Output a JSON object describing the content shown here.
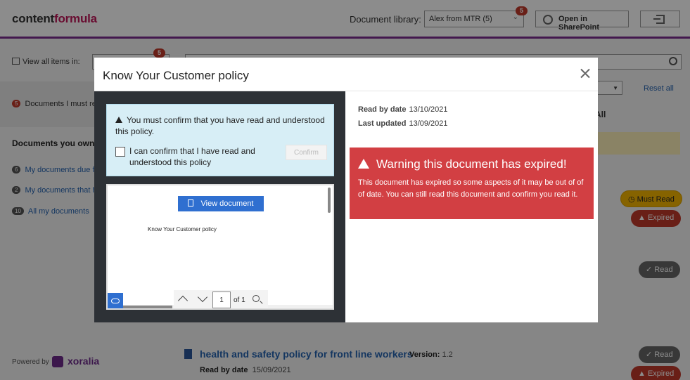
{
  "header": {
    "logo_part1": "content",
    "logo_part2": "formula",
    "doclib_label": "Document library:",
    "doclib_value": "Alex from MTR (5)",
    "doclib_badge": "5",
    "open_sharepoint": "Open in SharePoint"
  },
  "background": {
    "view_all_label": "View all items in:",
    "view_all_badge": "5",
    "docs_must_read_count": "5",
    "docs_must_read": "Documents I must re",
    "reset_all": "Reset all",
    "all_label": "All",
    "own_title": "Documents you own",
    "own_items": [
      {
        "count": "6",
        "label": "My documents due f"
      },
      {
        "count": "2",
        "label": "My documents that h"
      },
      {
        "count": "10",
        "label": "All my documents"
      }
    ],
    "status_must_read": "Must Read",
    "status_expired": "Expired",
    "status_read": "Read",
    "powered_by": "Powered by",
    "xoralia": "xoralia",
    "doc_title": "health and safety policy for front line workers",
    "doc_version_label": "Version:",
    "doc_version_value": "1.2",
    "doc_read_label": "Read by date",
    "doc_read_value": "15/09/2021"
  },
  "modal": {
    "title": "Know Your Customer policy",
    "confirm_message": "You must confirm that you have read and understood this policy.",
    "checkbox_label": "I can confirm that I have read and understood this policy",
    "confirm_button": "Confirm",
    "view_document": "View document",
    "doc_page_text": "Know Your Customer policy",
    "page_number": "1",
    "page_of": "of 1",
    "read_by_label": "Read by date",
    "read_by_value": "13/10/2021",
    "updated_label": "Last updated",
    "updated_value": "13/09/2021",
    "warning_title": "Warning this document has expired!",
    "warning_text": "This document has expired so some aspects of it may be out of of of date. You can still read this document and confirm you read it."
  }
}
